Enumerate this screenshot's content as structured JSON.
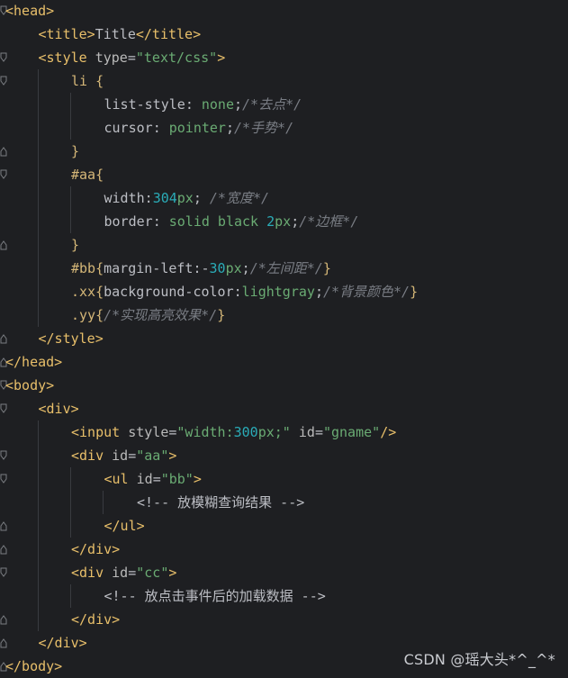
{
  "lines": [
    {
      "indent": 0,
      "fold": "open",
      "tokens": [
        [
          "tag",
          "<head>"
        ]
      ]
    },
    {
      "indent": 1,
      "fold": "",
      "tokens": [
        [
          "tag",
          "<title>"
        ],
        [
          "plain",
          "Title"
        ],
        [
          "tag",
          "</title>"
        ]
      ]
    },
    {
      "indent": 1,
      "fold": "open",
      "tokens": [
        [
          "tag",
          "<style "
        ],
        [
          "attr",
          "type"
        ],
        [
          "plain",
          "="
        ],
        [
          "str",
          "\"text/css\""
        ],
        [
          "tag",
          ">"
        ]
      ]
    },
    {
      "indent": 2,
      "fold": "open",
      "tokens": [
        [
          "sel",
          "li "
        ],
        [
          "brace",
          "{"
        ]
      ]
    },
    {
      "indent": 3,
      "fold": "",
      "tokens": [
        [
          "prop",
          "list-style"
        ],
        [
          "plain",
          ": "
        ],
        [
          "val",
          "none"
        ],
        [
          "plain",
          ";"
        ],
        [
          "comment",
          "/*去点*/"
        ]
      ]
    },
    {
      "indent": 3,
      "fold": "",
      "tokens": [
        [
          "prop",
          "cursor"
        ],
        [
          "plain",
          ": "
        ],
        [
          "val",
          "pointer"
        ],
        [
          "plain",
          ";"
        ],
        [
          "comment",
          "/*手势*/"
        ]
      ]
    },
    {
      "indent": 2,
      "fold": "close",
      "tokens": [
        [
          "brace",
          "}"
        ]
      ]
    },
    {
      "indent": 2,
      "fold": "open",
      "tokens": [
        [
          "sel",
          "#aa"
        ],
        [
          "brace",
          "{"
        ]
      ]
    },
    {
      "indent": 3,
      "fold": "",
      "tokens": [
        [
          "prop",
          "width"
        ],
        [
          "plain",
          ":"
        ],
        [
          "num",
          "304"
        ],
        [
          "unit",
          "px"
        ],
        [
          "plain",
          "; "
        ],
        [
          "comment",
          "/*宽度*/"
        ]
      ]
    },
    {
      "indent": 3,
      "fold": "",
      "tokens": [
        [
          "prop",
          "border"
        ],
        [
          "plain",
          ": "
        ],
        [
          "val",
          "solid black "
        ],
        [
          "num",
          "2"
        ],
        [
          "unit",
          "px"
        ],
        [
          "plain",
          ";"
        ],
        [
          "comment",
          "/*边框*/"
        ]
      ]
    },
    {
      "indent": 2,
      "fold": "close",
      "tokens": [
        [
          "brace",
          "}"
        ]
      ]
    },
    {
      "indent": 2,
      "fold": "",
      "tokens": [
        [
          "sel",
          "#bb"
        ],
        [
          "brace",
          "{"
        ],
        [
          "prop",
          "margin-left"
        ],
        [
          "plain",
          ":-"
        ],
        [
          "num",
          "30"
        ],
        [
          "unit",
          "px"
        ],
        [
          "plain",
          ";"
        ],
        [
          "comment",
          "/*左间距*/"
        ],
        [
          "brace",
          "}"
        ]
      ]
    },
    {
      "indent": 2,
      "fold": "",
      "tokens": [
        [
          "sel",
          ".xx"
        ],
        [
          "brace",
          "{"
        ],
        [
          "prop",
          "background-color"
        ],
        [
          "plain",
          ":"
        ],
        [
          "val",
          "lightgray"
        ],
        [
          "plain",
          ";"
        ],
        [
          "comment",
          "/*背景颜色*/"
        ],
        [
          "brace",
          "}"
        ]
      ]
    },
    {
      "indent": 2,
      "fold": "",
      "tokens": [
        [
          "sel",
          ".yy"
        ],
        [
          "brace",
          "{"
        ],
        [
          "comment",
          "/*实现高亮效果*/"
        ],
        [
          "brace",
          "}"
        ]
      ]
    },
    {
      "indent": 1,
      "fold": "close",
      "tokens": [
        [
          "tag",
          "</style>"
        ]
      ]
    },
    {
      "indent": 0,
      "fold": "close",
      "tokens": [
        [
          "tag",
          "</head>"
        ]
      ]
    },
    {
      "indent": 0,
      "fold": "open",
      "tokens": [
        [
          "tag",
          "<body>"
        ]
      ]
    },
    {
      "indent": 1,
      "fold": "open",
      "tokens": [
        [
          "tag",
          "<div>"
        ]
      ]
    },
    {
      "indent": 2,
      "fold": "",
      "tokens": [
        [
          "tag",
          "<input "
        ],
        [
          "attr",
          "style"
        ],
        [
          "plain",
          "="
        ],
        [
          "str",
          "\"width:"
        ],
        [
          "num",
          "300"
        ],
        [
          "str",
          "px;\""
        ],
        [
          "attr",
          " id"
        ],
        [
          "plain",
          "="
        ],
        [
          "str",
          "\"gname\""
        ],
        [
          "tag",
          "/>"
        ]
      ]
    },
    {
      "indent": 2,
      "fold": "open",
      "tokens": [
        [
          "tag",
          "<div "
        ],
        [
          "attr",
          "id"
        ],
        [
          "plain",
          "="
        ],
        [
          "str",
          "\"aa\""
        ],
        [
          "tag",
          ">"
        ]
      ]
    },
    {
      "indent": 3,
      "fold": "open",
      "tokens": [
        [
          "tag",
          "<ul "
        ],
        [
          "attr",
          "id"
        ],
        [
          "plain",
          "="
        ],
        [
          "str",
          "\"bb\""
        ],
        [
          "tag",
          ">"
        ]
      ]
    },
    {
      "indent": 4,
      "fold": "",
      "tokens": [
        [
          "plain",
          "<!-- 放模糊查询结果 -->"
        ]
      ]
    },
    {
      "indent": 3,
      "fold": "close",
      "tokens": [
        [
          "tag",
          "</ul>"
        ]
      ]
    },
    {
      "indent": 2,
      "fold": "close",
      "tokens": [
        [
          "tag",
          "</div>"
        ]
      ]
    },
    {
      "indent": 2,
      "fold": "open",
      "tokens": [
        [
          "tag",
          "<div "
        ],
        [
          "attr",
          "id"
        ],
        [
          "plain",
          "="
        ],
        [
          "str",
          "\"cc\""
        ],
        [
          "tag",
          ">"
        ]
      ]
    },
    {
      "indent": 3,
      "fold": "",
      "tokens": [
        [
          "plain",
          "<!-- 放点击事件后的加载数据 -->"
        ]
      ]
    },
    {
      "indent": 2,
      "fold": "close",
      "tokens": [
        [
          "tag",
          "</div>"
        ]
      ]
    },
    {
      "indent": 1,
      "fold": "close",
      "tokens": [
        [
          "tag",
          "</div>"
        ]
      ]
    },
    {
      "indent": 0,
      "fold": "close",
      "tokens": [
        [
          "tag",
          "</body>"
        ]
      ]
    }
  ],
  "watermark": "CSDN @瑶大头*^_^*"
}
